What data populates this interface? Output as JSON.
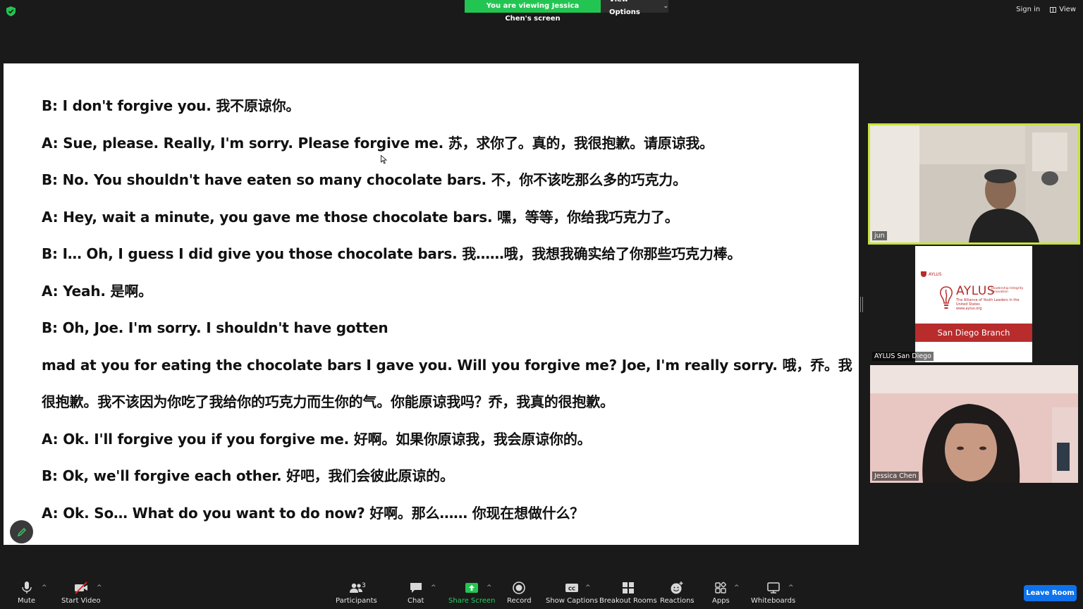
{
  "banner": {
    "viewing_text": "You are viewing Jessica Chen's screen",
    "view_options": "View Options"
  },
  "top_right": {
    "sign_in": "Sign in",
    "view": "View"
  },
  "document": {
    "lines": [
      "B: I don't forgive you. 我不原谅你。",
      "A: Sue, please. Really, I'm sorry. Please forgive me. 苏，求你了。真的，我很抱歉。请原谅我。",
      "B: No. You shouldn't have eaten so many chocolate bars. 不，你不该吃那么多的巧克力。",
      "A: Hey, wait a minute, you gave me those chocolate bars. 嘿，等等，你给我巧克力了。",
      "B: I… Oh, I guess I did give you those chocolate bars. 我……哦，我想我确实给了你那些巧克力棒。",
      "A: Yeah. 是啊。",
      "B: Oh, Joe. I'm sorry. I shouldn't have gotten",
      "mad at you for eating the chocolate bars I gave you. Will you forgive me? Joe, I'm really sorry. 哦，乔。我",
      "很抱歉。我不该因为你吃了我给你的巧克力而生你的气。你能原谅我吗？乔，我真的很抱歉。",
      "A: Ok. I'll forgive you if you forgive me. 好啊。如果你原谅我，我会原谅你的。",
      "B: Ok, we'll forgive each other. 好吧，我们会彼此原谅的。",
      "A: Ok. So… What do you want to do now? 好啊。那么…… 你现在想做什么？"
    ]
  },
  "participants_tiles": [
    {
      "name": "jun"
    },
    {
      "name": "AYLUS San Diego"
    },
    {
      "name": "Jessica Chen"
    }
  ],
  "aylus_card": {
    "small_logo": "AYLUS",
    "brand": "AYLUS",
    "tagline": "Leadership Integrity Innovation",
    "subtitle": "The Alliance of Youth Leaders in the United States",
    "url": "www.aylus.org",
    "band": "San Diego Branch",
    "brand_color": "#b82c2c"
  },
  "toolbar": {
    "mute": "Mute",
    "start_video": "Start Video",
    "participants": "Participants",
    "participants_count": "3",
    "chat": "Chat",
    "share_screen": "Share Screen",
    "record": "Record",
    "show_captions": "Show Captions",
    "breakout_rooms": "Breakout Rooms",
    "reactions": "Reactions",
    "apps": "Apps",
    "whiteboards": "Whiteboards",
    "leave_room": "Leave Room"
  },
  "colors": {
    "share_green": "#23c552",
    "active_speaker": "#c6e43a",
    "leave_blue": "#0e72ed"
  }
}
